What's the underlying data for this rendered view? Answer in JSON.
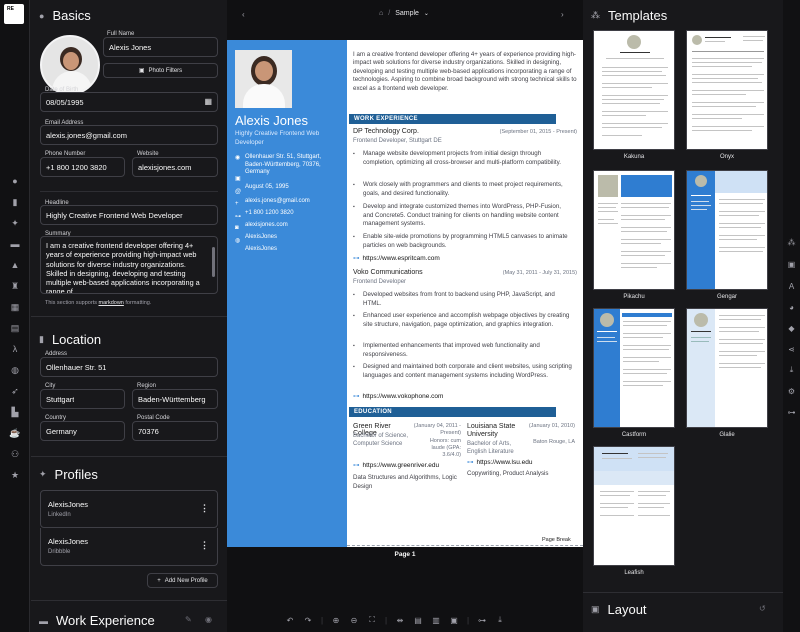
{
  "left_rail": {
    "logo": "RE"
  },
  "basics": {
    "title": "Basics",
    "full_name_label": "Full Name",
    "full_name": "Alexis Jones",
    "photo_filters": "Photo Filters",
    "dob_label": "Date of Birth",
    "dob": "08/05/1995",
    "email_label": "Email Address",
    "email": "alexis.jones@gmail.com",
    "phone_label": "Phone Number",
    "phone": "+1 800 1200 3820",
    "website_label": "Website",
    "website": "alexisjones.com",
    "headline_label": "Headline",
    "headline": "Highly Creative Frontend Web Developer",
    "summary_label": "Summary",
    "summary": "I am a creative frontend developer offering 4+ years of experience providing high-impact web solutions for diverse industry organizations. Skilled in designing, developing and testing multiple web-based applications incorporating a range of",
    "markdown_note_pre": "This section supports",
    "markdown_link": "markdown",
    "markdown_note_post": "formatting."
  },
  "location": {
    "title": "Location",
    "address_label": "Address",
    "address": "Ollenhauer Str. 51",
    "city_label": "City",
    "city": "Stuttgart",
    "region_label": "Region",
    "region": "Baden-Württemberg",
    "country_label": "Country",
    "country": "Germany",
    "postal_label": "Postal Code",
    "postal": "70376"
  },
  "profiles": {
    "title": "Profiles",
    "items": [
      {
        "name": "AlexisJones",
        "network": "LinkedIn"
      },
      {
        "name": "AlexisJones",
        "network": "Dribbble"
      }
    ],
    "add_button": "Add New Profile"
  },
  "work_experience_title": "Work Experience",
  "topbar": {
    "breadcrumb": "Sample"
  },
  "resume": {
    "name": "Alexis Jones",
    "headline": "Highly Creative Frontend Web Developer",
    "contact": {
      "address": "Ollenhauer Str. 51, Stuttgart, Baden-Württemberg, 70376, Germany",
      "dob": "August 05, 1995",
      "email": "alexis.jones@gmail.com",
      "phone": "+1 800 1200 3820",
      "website": "alexisjones.com",
      "profile1": "AlexisJones",
      "profile2": "AlexisJones"
    },
    "summary": "I am a creative frontend developer offering 4+ years of experience providing high-impact web solutions for diverse industry organizations. Skilled in designing, developing and testing multiple web-based applications incorporating a range of technologies. Aspiring to combine broad background with strong technical skills to excel as a frontend web developer.",
    "work_heading": "WORK EXPERIENCE",
    "job1": {
      "company": "DP Technology Corp.",
      "dates": "(September 01, 2015 - Present)",
      "role": "Frontend Developer, Stuttgart DE",
      "bullets": [
        "Manage website development projects from initial design through completion, optimizing all cross-browser and multi-platform compatibility.",
        "Work closely with programmers and clients to meet project requirements, goals, and desired functionality.",
        "Develop and integrate customized themes into WordPress, PHP-Fusion, and Concrete5. Conduct training for clients on handling website content management systems.",
        "Enable site-wide promotions by programming HTML5 canvases to animate particles on web backgrounds."
      ],
      "link": "https://www.espritcam.com"
    },
    "job2": {
      "company": "Voko Communications",
      "dates": "(May 31, 2011 - July 31, 2015)",
      "role": "Frontend Developer",
      "bullets": [
        "Developed websites from front to backend using PHP, JavaScript, and HTML.",
        "Enhanced user experience and accomplish webpage objectives by creating site structure, navigation, page optimization, and graphics integration.",
        "Implemented enhancements that improved web functionality and responsiveness.",
        "Designed and maintained both corporate and client websites, using scripting languages and content management systems including WordPress."
      ],
      "link": "https://www.vokophone.com"
    },
    "edu_heading": "EDUCATION",
    "edu1": {
      "school": "Green River College",
      "dates": "(January 04, 2011 - Present)",
      "degree": "Bachelor of Science, Computer Science",
      "honors": "Honors: cum laude (GPA: 3.6/4.0)",
      "link": "https://www.greenriver.edu",
      "courses": "Data Structures and Algorithms, Logic Design"
    },
    "edu2": {
      "school": "Louisiana State University",
      "dates": "(January 01, 2010)",
      "degree": "Bachelor of Arts, English Literature",
      "location": "Baton Rouge, LA",
      "link": "https://www.lsu.edu",
      "courses": "Copywriting, Product Analysis"
    },
    "page_break": "Page Break",
    "page_label": "Page 1"
  },
  "templates": {
    "title": "Templates",
    "items": [
      "Kakuna",
      "Onyx",
      "Pikachu",
      "Gengar",
      "Castform",
      "Glalie",
      "Leafish"
    ]
  },
  "layout_title": "Layout",
  "colors": {
    "accent": "#3b8ad9",
    "section": "#1f5f96",
    "dark": "#18181b"
  }
}
